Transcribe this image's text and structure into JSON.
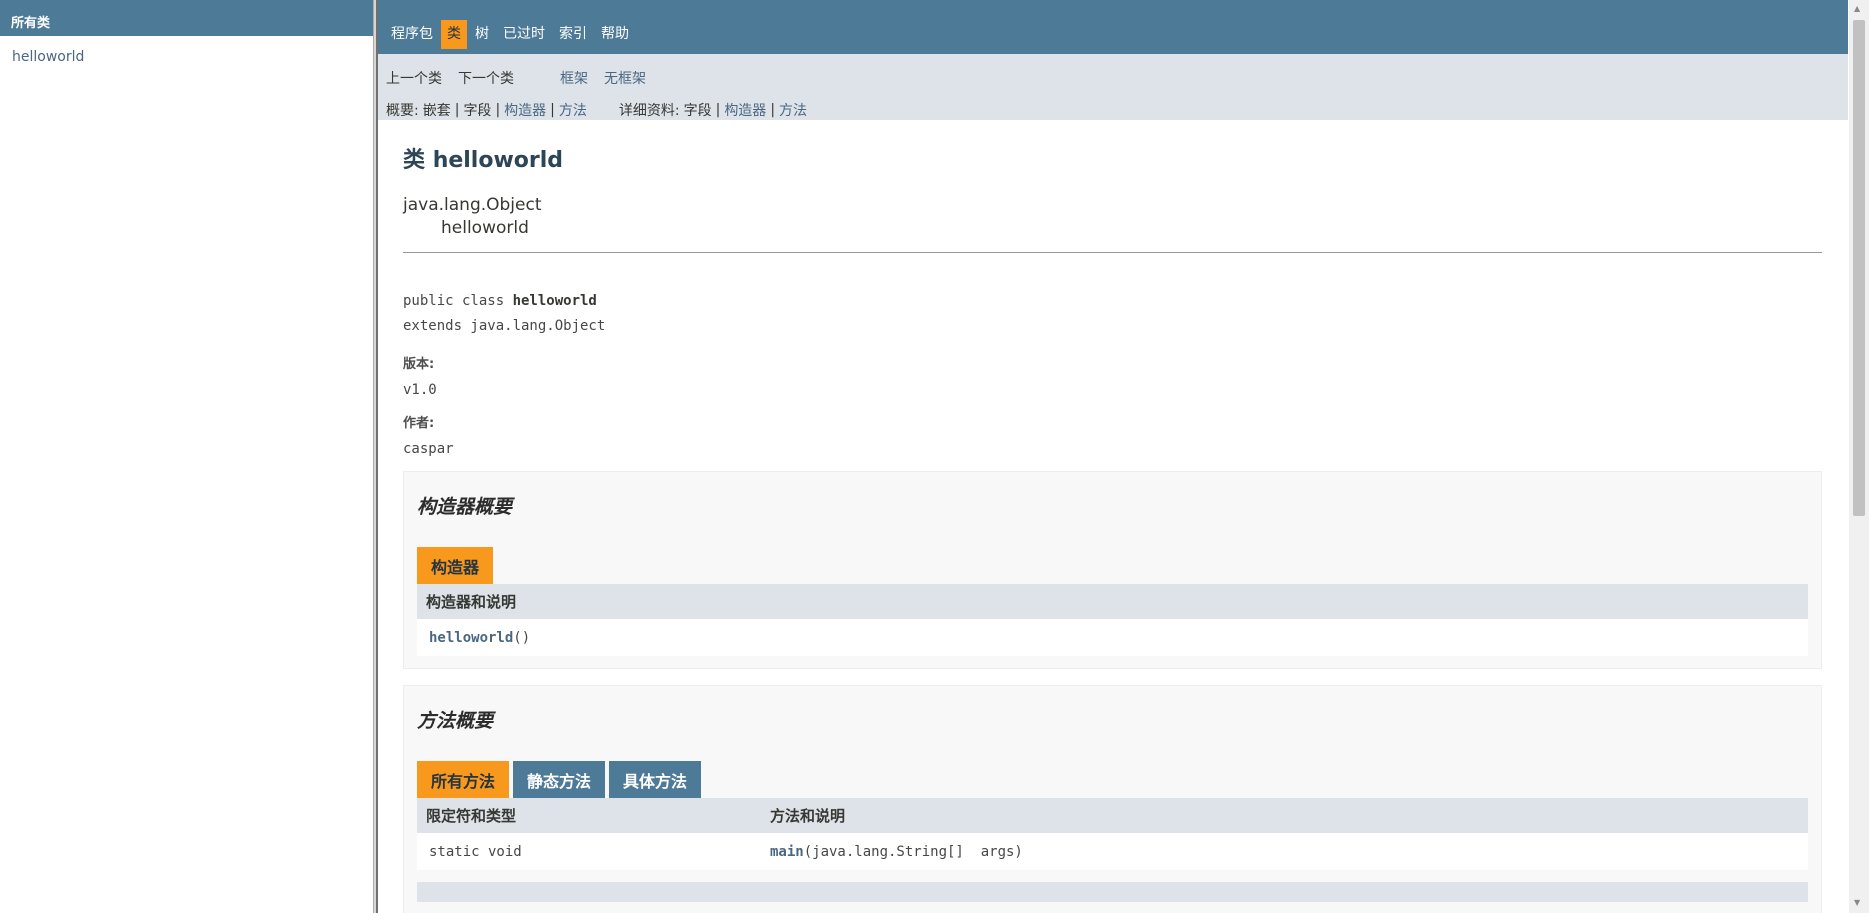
{
  "left_frame": {
    "header": "所有类",
    "classes": [
      "helloworld"
    ]
  },
  "top_nav": {
    "items": [
      "程序包",
      "类",
      "树",
      "已过时",
      "索引",
      "帮助"
    ],
    "active": "类"
  },
  "sub_nav": {
    "prev_class": "上一个类",
    "next_class": "下一个类",
    "frames": "框架",
    "no_frames": "无框架",
    "summary_label": "概要:",
    "summary_nested": "嵌套",
    "summary_field": "字段",
    "summary_constructor": "构造器",
    "summary_method": "方法",
    "detail_label": "详细资料:",
    "detail_field": "字段",
    "detail_constructor": "构造器",
    "detail_method": "方法",
    "sep": "|"
  },
  "class_info": {
    "title_prefix": "类",
    "title_name": "helloworld",
    "parent": "java.lang.Object",
    "child": "helloworld",
    "signature_prefix": "public class ",
    "signature_name": "helloworld",
    "signature_extends": "extends java.lang.Object",
    "version_label": "版本:",
    "version_value": "v1.0",
    "author_label": "作者:",
    "author_value": "caspar"
  },
  "constructor_summary": {
    "title": "构造器概要",
    "tab": "构造器",
    "header": "构造器和说明",
    "rows": [
      {
        "name": "helloworld",
        "params": "()"
      }
    ]
  },
  "method_summary": {
    "title": "方法概要",
    "tabs": [
      "所有方法",
      "静态方法",
      "具体方法"
    ],
    "header_col1": "限定符和类型",
    "header_col2": "方法和说明",
    "rows": [
      {
        "type": "static void",
        "name": "main",
        "params": "(java.lang.String[]  args)"
      }
    ]
  }
}
